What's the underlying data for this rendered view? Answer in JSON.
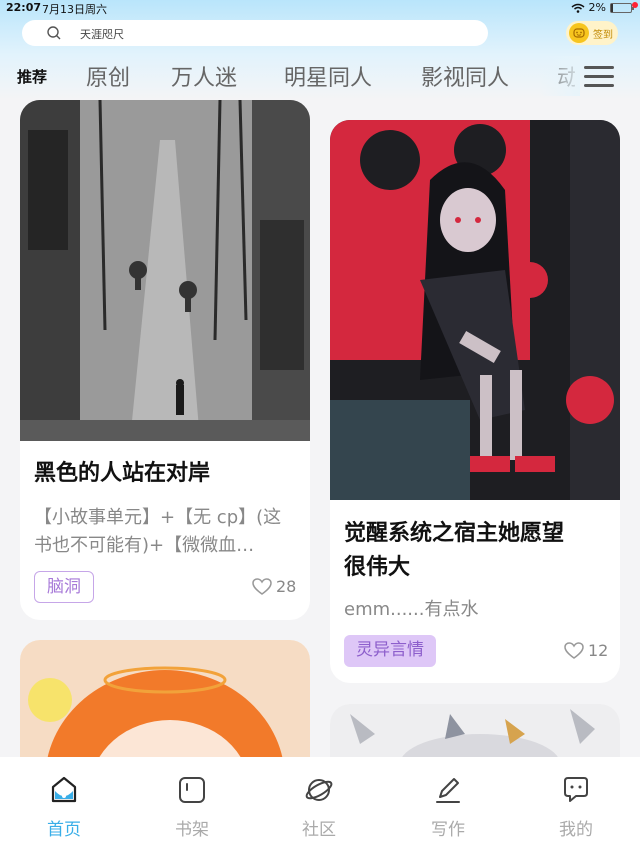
{
  "status": {
    "time": "22:07",
    "date": "7月13日周六",
    "battery": "2%"
  },
  "search": {
    "placeholder": "天涯咫尺"
  },
  "checkin": {
    "label": "签到"
  },
  "tabs": [
    "推荐",
    "原创",
    "万人迷",
    "明星同人",
    "影视同人",
    "动"
  ],
  "cards": [
    {
      "title": "黑色的人站在对岸",
      "desc_line1": "【小故事单元】+【无 cp】(这",
      "desc_line2": "书也不可能有)+【微微血…",
      "tag": "脑洞",
      "likes": "28"
    },
    {
      "title_line1": "觉醒系统之宿主她愿望",
      "title_line2": "很伟大",
      "desc": "emm......有点水",
      "tag": "灵异言情",
      "likes": "12"
    }
  ],
  "nav": [
    {
      "label": "首页",
      "icon": "home-icon"
    },
    {
      "label": "书架",
      "icon": "bookshelf-icon"
    },
    {
      "label": "社区",
      "icon": "planet-icon"
    },
    {
      "label": "写作",
      "icon": "pencil-icon"
    },
    {
      "label": "我的",
      "icon": "chat-bubble-icon"
    }
  ],
  "colors": {
    "accent": "#39aee8",
    "tag_purple": "#a779d8",
    "header_blue": "#b9e5fb"
  }
}
